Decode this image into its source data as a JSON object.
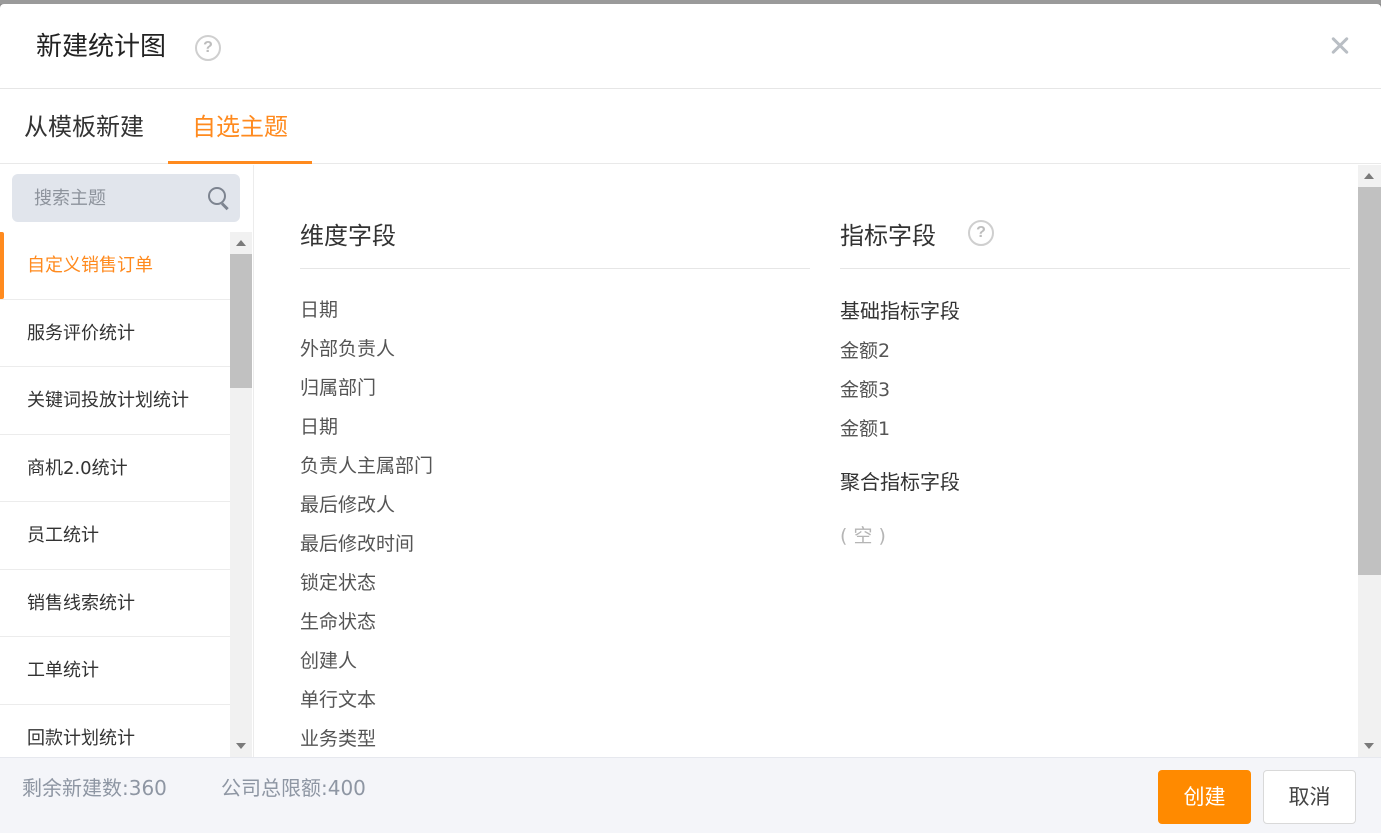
{
  "dialog": {
    "title": "新建统计图",
    "help_glyph": "?"
  },
  "tabs": [
    {
      "label": "从模板新建",
      "active": false
    },
    {
      "label": "自选主题",
      "active": true
    }
  ],
  "sidebar": {
    "search_placeholder": "搜索主题",
    "items": [
      {
        "label": "自定义销售订单",
        "active": true
      },
      {
        "label": "服务评价统计"
      },
      {
        "label": "关键词投放计划统计"
      },
      {
        "label": "商机2.0统计"
      },
      {
        "label": "员工统计"
      },
      {
        "label": "销售线索统计"
      },
      {
        "label": "工单统计"
      },
      {
        "label": "回款计划统计"
      }
    ]
  },
  "dimension": {
    "title": "维度字段",
    "fields": [
      "日期",
      "外部负责人",
      "归属部门",
      "日期",
      "负责人主属部门",
      "最后修改人",
      "最后修改时间",
      "锁定状态",
      "生命状态",
      "创建人",
      "单行文本",
      "业务类型"
    ]
  },
  "metric": {
    "title": "指标字段",
    "help_glyph": "?",
    "base_title": "基础指标字段",
    "base_fields": [
      "金额2",
      "金额3",
      "金额1"
    ],
    "agg_title": "聚合指标字段",
    "agg_empty": "( 空 )"
  },
  "footer": {
    "remaining": "剩余新建数:360",
    "limit": "公司总限额:400",
    "create_label": "创建",
    "cancel_label": "取消"
  },
  "colors": {
    "accent": "#ff8a1e",
    "button_primary": "#ff8a00"
  }
}
